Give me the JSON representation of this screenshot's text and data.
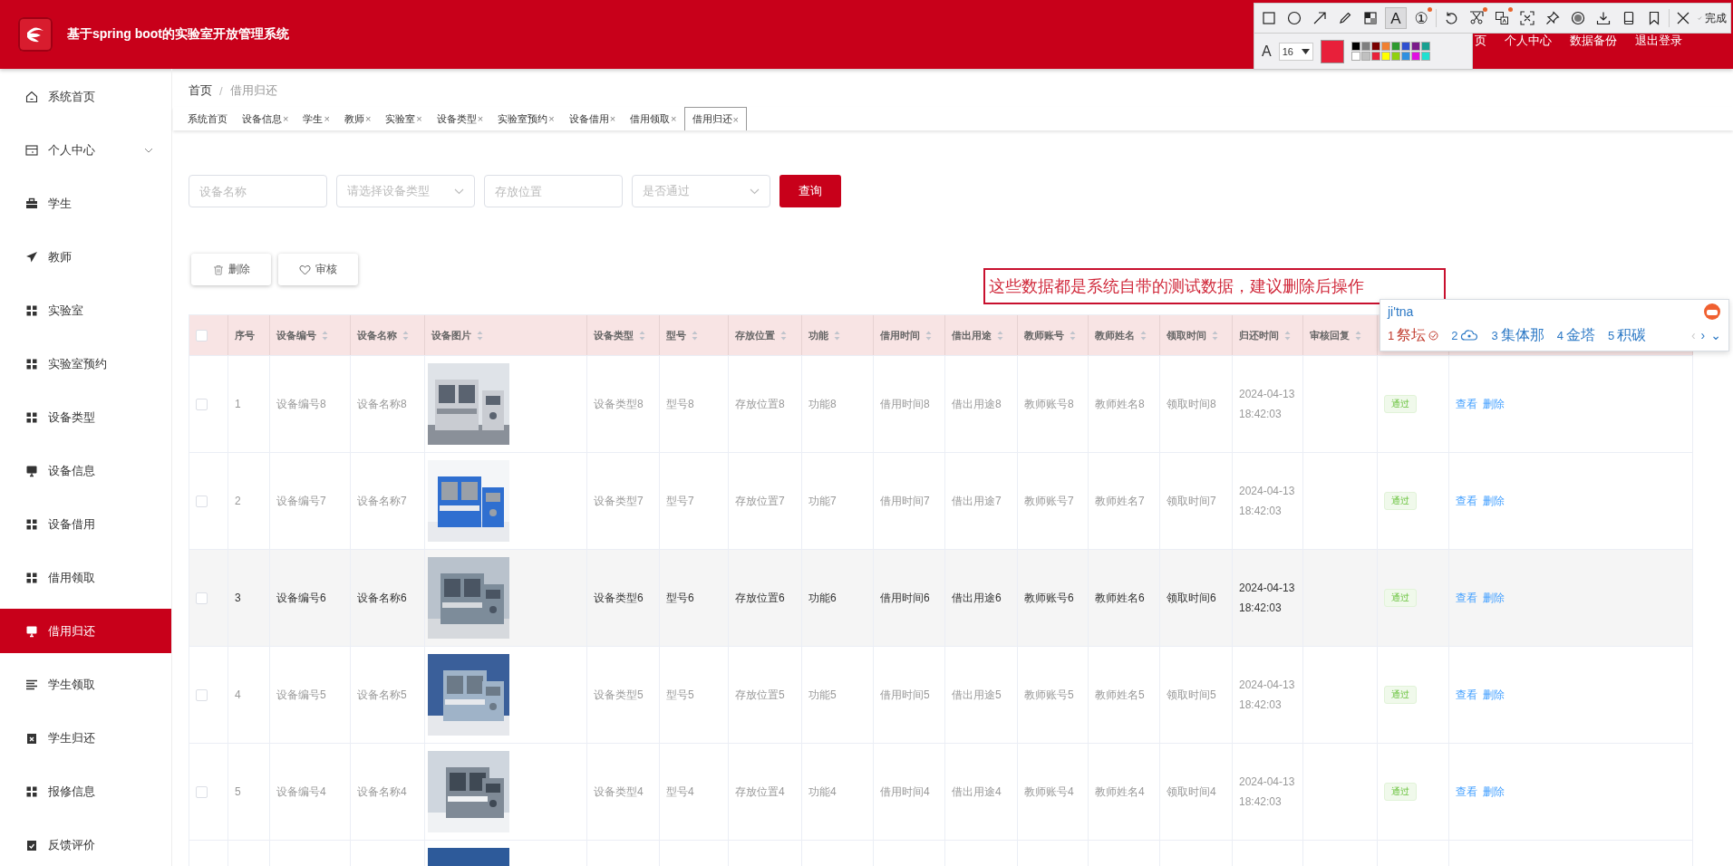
{
  "header": {
    "title": "基于spring boot的实验室开放管理系统",
    "nav": [
      "页",
      "个人中心",
      "数据备份",
      "退出登录"
    ]
  },
  "overlay_toolbar": {
    "tool_groups": [
      [
        {
          "kind": "rect",
          "selected": false,
          "badge": false
        },
        {
          "kind": "circle",
          "selected": false,
          "badge": false
        },
        {
          "kind": "arrow",
          "selected": false,
          "badge": false
        },
        {
          "kind": "pencil",
          "selected": false,
          "badge": false
        },
        {
          "kind": "mosaic",
          "selected": false,
          "badge": false
        },
        {
          "kind": "text",
          "label": "A",
          "selected": true,
          "badge": false
        },
        {
          "kind": "number",
          "label": "①",
          "selected": false,
          "badge": true
        }
      ],
      [
        {
          "kind": "undo",
          "selected": false,
          "badge": false
        },
        {
          "kind": "scissors",
          "selected": false,
          "badge": true
        },
        {
          "kind": "translate",
          "selected": false,
          "badge": true
        },
        {
          "kind": "ocr",
          "selected": false,
          "badge": false
        },
        {
          "kind": "pin",
          "selected": false,
          "badge": false
        },
        {
          "kind": "record",
          "selected": false,
          "badge": false
        },
        {
          "kind": "download",
          "selected": false,
          "badge": false
        },
        {
          "kind": "phone",
          "selected": false,
          "badge": false
        },
        {
          "kind": "bookmark",
          "selected": false,
          "badge": false
        }
      ],
      [
        {
          "kind": "close",
          "selected": false,
          "badge": false
        },
        {
          "kind": "done",
          "label": "完成",
          "selected": false,
          "badge": false
        }
      ]
    ],
    "font_label": "A",
    "font_size": "16",
    "current": {
      "color": "#e8203a"
    },
    "palette": [
      {
        "color": "#000000"
      },
      {
        "color": "#7f7f7f"
      },
      {
        "color": "#7a0000"
      },
      {
        "color": "#f08030"
      },
      {
        "color": "#2e9a2e"
      },
      {
        "color": "#3050d0"
      },
      {
        "color": "#7a1a8a"
      },
      {
        "color": "#16a090"
      },
      {
        "color": "#ffffff"
      },
      {
        "color": "#c0c0c0"
      },
      {
        "color": "#e8203a"
      },
      {
        "color": "#ffff00"
      },
      {
        "color": "#90d010"
      },
      {
        "color": "#3090e0"
      },
      {
        "color": "#e010e0"
      },
      {
        "color": "#20e0d0"
      }
    ]
  },
  "sidebar": {
    "items": [
      {
        "label": "系统首页",
        "selected": false,
        "expandable": false
      },
      {
        "label": "个人中心",
        "selected": false,
        "expandable": true
      },
      {
        "label": "学生",
        "selected": false,
        "expandable": false
      },
      {
        "label": "教师",
        "selected": false,
        "expandable": false
      },
      {
        "label": "实验室",
        "selected": false,
        "expandable": false
      },
      {
        "label": "实验室预约",
        "selected": false,
        "expandable": false
      },
      {
        "label": "设备类型",
        "selected": false,
        "expandable": false
      },
      {
        "label": "设备信息",
        "selected": false,
        "expandable": false
      },
      {
        "label": "设备借用",
        "selected": false,
        "expandable": false
      },
      {
        "label": "借用领取",
        "selected": false,
        "expandable": false
      },
      {
        "label": "借用归还",
        "selected": true,
        "expandable": false
      },
      {
        "label": "学生领取",
        "selected": false,
        "expandable": false
      },
      {
        "label": "学生归还",
        "selected": false,
        "expandable": false
      },
      {
        "label": "报修信息",
        "selected": false,
        "expandable": false
      },
      {
        "label": "反馈评价",
        "selected": false,
        "expandable": false
      }
    ]
  },
  "breadcrumb": [
    "首页",
    "/",
    "借用归还"
  ],
  "tabs": [
    {
      "label": "系统首页",
      "selected": false
    },
    {
      "label": "设备信息",
      "close": "×",
      "selected": false
    },
    {
      "label": "学生",
      "close": "×",
      "selected": false
    },
    {
      "label": "教师",
      "close": "×",
      "selected": false
    },
    {
      "label": "实验室",
      "close": "×",
      "selected": false
    },
    {
      "label": "设备类型",
      "close": "×",
      "selected": false
    },
    {
      "label": "实验室预约",
      "close": "×",
      "selected": false
    },
    {
      "label": "设备借用",
      "close": "×",
      "selected": false
    },
    {
      "label": "借用领取",
      "close": "×",
      "selected": false
    },
    {
      "label": "借用归还",
      "close": "×",
      "selected": true
    }
  ],
  "filters": [
    {
      "kind": "input",
      "placeholder": "设备名称"
    },
    {
      "kind": "select",
      "placeholder": "请选择设备类型"
    },
    {
      "kind": "input",
      "placeholder": "存放位置"
    },
    {
      "kind": "select",
      "placeholder": "是否通过"
    }
  ],
  "search_button": "查询",
  "actions": [
    {
      "kind": "delete",
      "label": "删除"
    },
    {
      "kind": "review",
      "label": "审核"
    }
  ],
  "annotation": {
    "text": "这些数据都是系统自带的测试数据，建议删除后操作"
  },
  "ime": {
    "input": "ji'tna",
    "candidates": [
      {
        "index": "1",
        "word": "祭坛",
        "selected": true
      },
      {
        "index": "2",
        "selected": false
      },
      {
        "index": "3",
        "word": "集体那",
        "selected": false
      },
      {
        "index": "4",
        "word": "金塔",
        "selected": false
      },
      {
        "index": "5",
        "word": "积碳",
        "selected": false
      }
    ],
    "nav": [
      "‹",
      "›",
      "⌄"
    ]
  },
  "table": {
    "all_checked": false,
    "columns": [
      {
        "label": "序号",
        "sortable": false
      },
      {
        "label": "设备编号",
        "sortable": true
      },
      {
        "label": "设备名称",
        "sortable": true
      },
      {
        "label": "设备图片",
        "sortable": true
      },
      {
        "label": "设备类型",
        "sortable": true
      },
      {
        "label": "型号",
        "sortable": true
      },
      {
        "label": "存放位置",
        "sortable": true
      },
      {
        "label": "功能",
        "sortable": true
      },
      {
        "label": "借用时间",
        "sortable": true
      },
      {
        "label": "借出用途",
        "sortable": true
      },
      {
        "label": "教师账号",
        "sortable": true
      },
      {
        "label": "教师姓名",
        "sortable": true
      },
      {
        "label": "领取时间",
        "sortable": true
      },
      {
        "label": "归还时间",
        "sortable": true
      },
      {
        "label": "审核回复",
        "sortable": true
      }
    ],
    "rows": [
      {
        "kind": "full",
        "checked": false,
        "highlighted": false,
        "index": "1",
        "code": "设备编号8",
        "name": "设备名称8",
        "image": {
          "kind": "picture"
        },
        "type": "设备类型8",
        "model": "型号8",
        "location": "存放位置8",
        "function": "功能8",
        "borrow_time": "借用时间8",
        "purpose": "借出用途8",
        "teacher_account": "教师账号8",
        "teacher_name": "教师姓名8",
        "pickup_time": "领取时间8",
        "return_time": "2024-04-13 18:42:03",
        "status": "通过",
        "links": [
          "查看",
          "删除"
        ]
      },
      {
        "kind": "full",
        "checked": false,
        "highlighted": false,
        "index": "2",
        "code": "设备编号7",
        "name": "设备名称7",
        "image": {
          "kind": "picture"
        },
        "type": "设备类型7",
        "model": "型号7",
        "location": "存放位置7",
        "function": "功能7",
        "borrow_time": "借用时间7",
        "purpose": "借出用途7",
        "teacher_account": "教师账号7",
        "teacher_name": "教师姓名7",
        "pickup_time": "领取时间7",
        "return_time": "2024-04-13 18:42:03",
        "status": "通过",
        "links": [
          "查看",
          "删除"
        ]
      },
      {
        "kind": "full",
        "checked": false,
        "highlighted": true,
        "index": "3",
        "code": "设备编号6",
        "name": "设备名称6",
        "image": {
          "kind": "picture"
        },
        "type": "设备类型6",
        "model": "型号6",
        "location": "存放位置6",
        "function": "功能6",
        "borrow_time": "借用时间6",
        "purpose": "借出用途6",
        "teacher_account": "教师账号6",
        "teacher_name": "教师姓名6",
        "pickup_time": "领取时间6",
        "return_time": "2024-04-13 18:42:03",
        "status": "通过",
        "links": [
          "查看",
          "删除"
        ]
      },
      {
        "kind": "full",
        "checked": false,
        "highlighted": false,
        "index": "4",
        "code": "设备编号5",
        "name": "设备名称5",
        "image": {
          "kind": "picture"
        },
        "type": "设备类型5",
        "model": "型号5",
        "location": "存放位置5",
        "function": "功能5",
        "borrow_time": "借用时间5",
        "purpose": "借出用途5",
        "teacher_account": "教师账号5",
        "teacher_name": "教师姓名5",
        "pickup_time": "领取时间5",
        "return_time": "2024-04-13 18:42:03",
        "status": "通过",
        "links": [
          "查看",
          "删除"
        ]
      },
      {
        "kind": "full",
        "checked": false,
        "highlighted": false,
        "index": "5",
        "code": "设备编号4",
        "name": "设备名称4",
        "image": {
          "kind": "picture"
        },
        "type": "设备类型4",
        "model": "型号4",
        "location": "存放位置4",
        "function": "功能4",
        "borrow_time": "借用时间4",
        "purpose": "借出用途4",
        "teacher_account": "教师账号4",
        "teacher_name": "教师姓名4",
        "pickup_time": "领取时间4",
        "return_time": "2024-04-13 18:42:03",
        "status": "通过",
        "links": [
          "查看",
          "删除"
        ]
      },
      {
        "kind": "cut",
        "image": {
          "kind": "picture"
        }
      }
    ]
  }
}
